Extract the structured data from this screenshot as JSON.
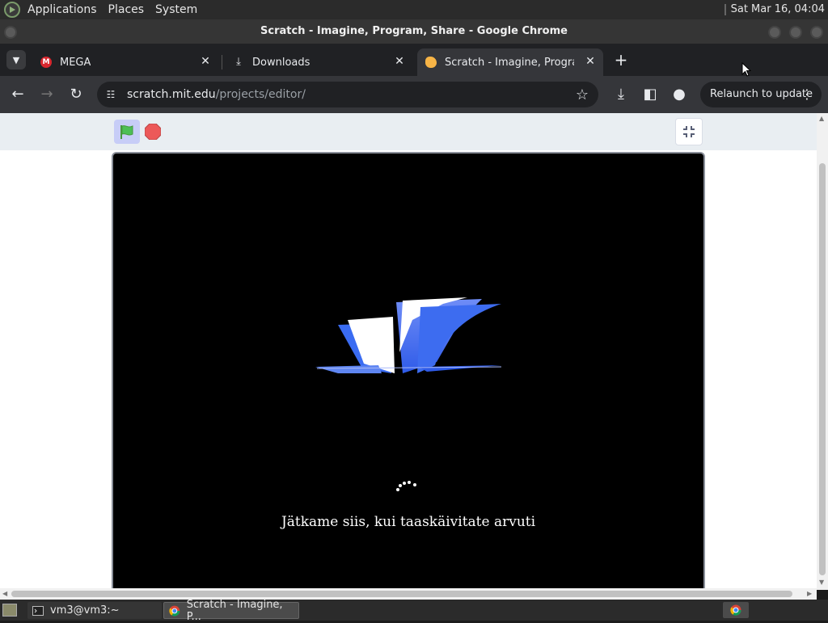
{
  "system_panel": {
    "menus": [
      "Applications",
      "Places",
      "System"
    ],
    "clock": "Sat Mar 16, 04:04"
  },
  "window": {
    "title": "Scratch - Imagine, Program, Share - Google Chrome"
  },
  "tabs": [
    {
      "title": "MEGA",
      "icon": "mega-icon",
      "active": false
    },
    {
      "title": "Downloads",
      "icon": "download-icon",
      "active": false
    },
    {
      "title": "Scratch - Imagine, Program,",
      "icon": "scratch-icon",
      "active": true
    }
  ],
  "toolbar": {
    "url_host": "scratch.mit.edu",
    "url_path": "/projects/editor/",
    "relaunch_label": "Relaunch to update"
  },
  "stage": {
    "loading_message": "Jätkame siis, kui taaskäivitate arvuti"
  },
  "taskbar": {
    "items": [
      {
        "title": "vm3@vm3:~",
        "icon": "terminal-icon"
      },
      {
        "title": "Scratch - Imagine, P...",
        "icon": "chrome-icon"
      }
    ]
  },
  "colors": {
    "stage_bg": "#000000",
    "flag_green": "#4cbf56",
    "stop_red": "#ec5959",
    "accent_blue": "#3d6cf0"
  }
}
